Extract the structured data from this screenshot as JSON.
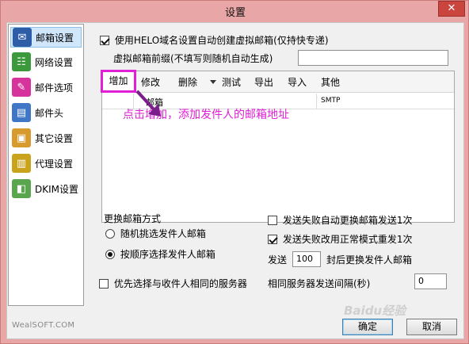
{
  "window": {
    "title": "设置",
    "close_glyph": "✕"
  },
  "sidebar": {
    "items": [
      {
        "label": "邮箱设置",
        "icon": "envelope-icon",
        "color": "#2e5da8",
        "glyph": "✉",
        "selected": true
      },
      {
        "label": "网络设置",
        "icon": "network-icon",
        "color": "#3c9a3c",
        "glyph": "☷"
      },
      {
        "label": "邮件选项",
        "icon": "mail-options-icon",
        "color": "#d6349c",
        "glyph": "✎"
      },
      {
        "label": "邮件头",
        "icon": "document-icon",
        "color": "#3f77c6",
        "glyph": "▤"
      },
      {
        "label": "其它设置",
        "icon": "package-icon",
        "color": "#d79a2c",
        "glyph": "▣"
      },
      {
        "label": "代理设置",
        "icon": "proxy-icon",
        "color": "#c9a31c",
        "glyph": "▥"
      },
      {
        "label": "DKIM设置",
        "icon": "dkim-icon",
        "color": "#5aa64e",
        "glyph": "◧"
      }
    ]
  },
  "main": {
    "helo_checkbox_label": "使用HELO域名设置自动创建虚拟邮箱(仅持快专递)",
    "helo_checked": true,
    "prefix_label": "虚拟邮箱前缀(不填写则随机自动生成)",
    "prefix_value": ""
  },
  "toolbar": {
    "add": "增加",
    "edit": "修改",
    "delete": "删除",
    "test": "测试",
    "export": "导出",
    "import": "导入",
    "other": "其他"
  },
  "grid": {
    "columns": [
      "邮箱",
      "SMTP"
    ]
  },
  "annotation": {
    "text": "点击增加，添加发件人的邮箱地址",
    "color": "#e01fd6"
  },
  "sender_mode": {
    "title": "更换邮箱方式",
    "options": [
      {
        "label": "随机挑选发件人邮箱",
        "checked": false
      },
      {
        "label": "按顺序选择发件人邮箱",
        "checked": true
      }
    ]
  },
  "options": {
    "auto_switch_label": "发送失败自动更换邮箱发送1次",
    "auto_switch_checked": false,
    "resend_label": "发送失败改用正常模式重发1次",
    "resend_checked": true,
    "send_prefix": "发送",
    "send_count": "100",
    "send_suffix": "封后更换发件人邮箱",
    "prefer_server_label": "优先选择与收件人相同的服务器",
    "prefer_server_checked": false,
    "interval_label": "相同服务器发送间隔(秒)",
    "interval_value": "0"
  },
  "footer": {
    "brand": "WealSOFT.COM",
    "ok": "确定",
    "cancel": "取消",
    "watermark": "Baidu经验"
  }
}
